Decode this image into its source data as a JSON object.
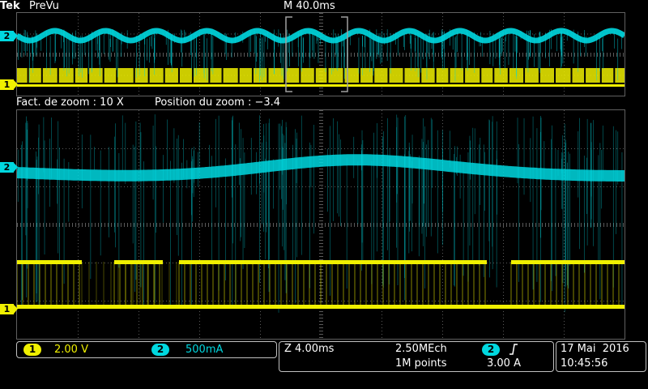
{
  "header": {
    "brand": "Tek",
    "mode": "PreVu",
    "timebase": "M 40.0ms"
  },
  "zoom": {
    "factor": "Fact. de zoom : 10 X",
    "position": "Position du zoom  : −3.4"
  },
  "channels": {
    "ch1": {
      "label": "1",
      "scale": "2.00 V",
      "color": "#f0f000"
    },
    "ch2": {
      "label": "2",
      "scale": "500mA",
      "color": "#00d8e0"
    }
  },
  "acquisition": {
    "zoom_timebase": "Z 4.00ms",
    "sample_rate": "2.50MEch",
    "record_length": "1M points",
    "trigger_channel": "2",
    "trigger_slope_icon": "rising-edge-icon",
    "trigger_level": "3.00 A"
  },
  "datetime": {
    "date": "17 Mai  2016",
    "time": "10:45:56"
  },
  "colors": {
    "grid": "#5a5a5a",
    "trigger_marker": "#ff9900",
    "zoom_window": "#a0a0a0"
  }
}
